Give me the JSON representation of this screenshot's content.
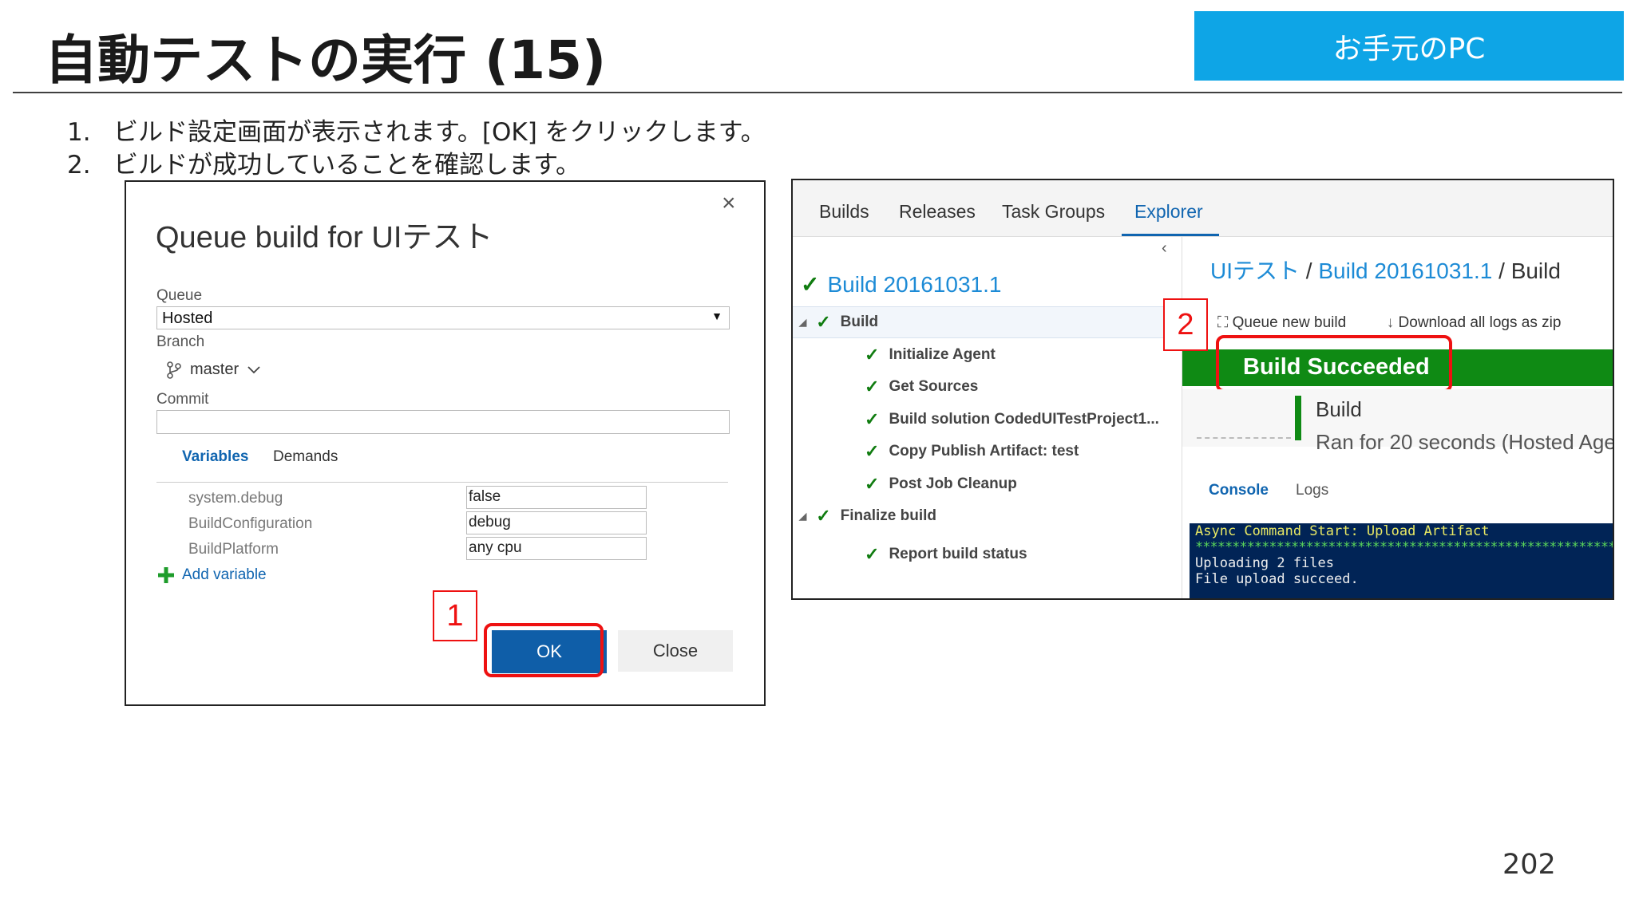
{
  "slide": {
    "title": "自動テストの実行 (15)",
    "badge": "お手元のPC",
    "steps": [
      {
        "num": "1.",
        "text": "ビルド設定画面が表示されます。[OK] をクリックします。"
      },
      {
        "num": "2.",
        "text": "ビルドが成功していることを確認します。"
      }
    ],
    "page_number": "202",
    "callouts": [
      "1",
      "2"
    ]
  },
  "dialog": {
    "title": "Queue build for UIテスト",
    "close_glyph": "×",
    "queue_label": "Queue",
    "queue_value": "Hosted",
    "branch_label": "Branch",
    "branch_value": "master",
    "commit_label": "Commit",
    "commit_value": "",
    "tabs": [
      "Variables",
      "Demands"
    ],
    "variables": [
      {
        "name": "system.debug",
        "value": "false"
      },
      {
        "name": "BuildConfiguration",
        "value": "debug"
      },
      {
        "name": "BuildPlatform",
        "value": "any cpu"
      }
    ],
    "add_variable": "Add variable",
    "ok_label": "OK",
    "close_label": "Close"
  },
  "build_view": {
    "nav_tabs": [
      "Builds",
      "Releases",
      "Task Groups",
      "Explorer"
    ],
    "active_tab": "Explorer",
    "build_number": "Build 20161031.1",
    "tree": [
      {
        "label": "Build",
        "level": 0
      },
      {
        "label": "Initialize Agent",
        "level": 1
      },
      {
        "label": "Get Sources",
        "level": 1
      },
      {
        "label": "Build solution CodedUITestProject1...",
        "level": 1
      },
      {
        "label": "Copy Publish Artifact: test",
        "level": 1
      },
      {
        "label": "Post Job Cleanup",
        "level": 1
      },
      {
        "label": "Finalize build",
        "level": 0
      },
      {
        "label": "Report build status",
        "level": 1
      }
    ],
    "breadcrumb": {
      "project": "UIテスト",
      "build": "Build 20161031.1",
      "current": "Build",
      "sep": "/"
    },
    "actions": {
      "queue_new": "Queue new build",
      "download": "Download all logs as zip"
    },
    "status": "Build Succeeded",
    "card_title": "Build",
    "card_subtitle": "Ran for 20 seconds (Hosted Age",
    "console_tabs": [
      "Console",
      "Logs"
    ],
    "console_lines": [
      "Async Command Start: Upload Artifact",
      "**********************************************************",
      "Uploading 2 files",
      "File upload succeed."
    ]
  },
  "colors": {
    "badge": "#0ea5e6",
    "link": "#1d8bd6",
    "success": "#0f8a14",
    "highlight": "#ee1111",
    "ok_button": "#0f5ea8",
    "console_bg": "#012456"
  }
}
